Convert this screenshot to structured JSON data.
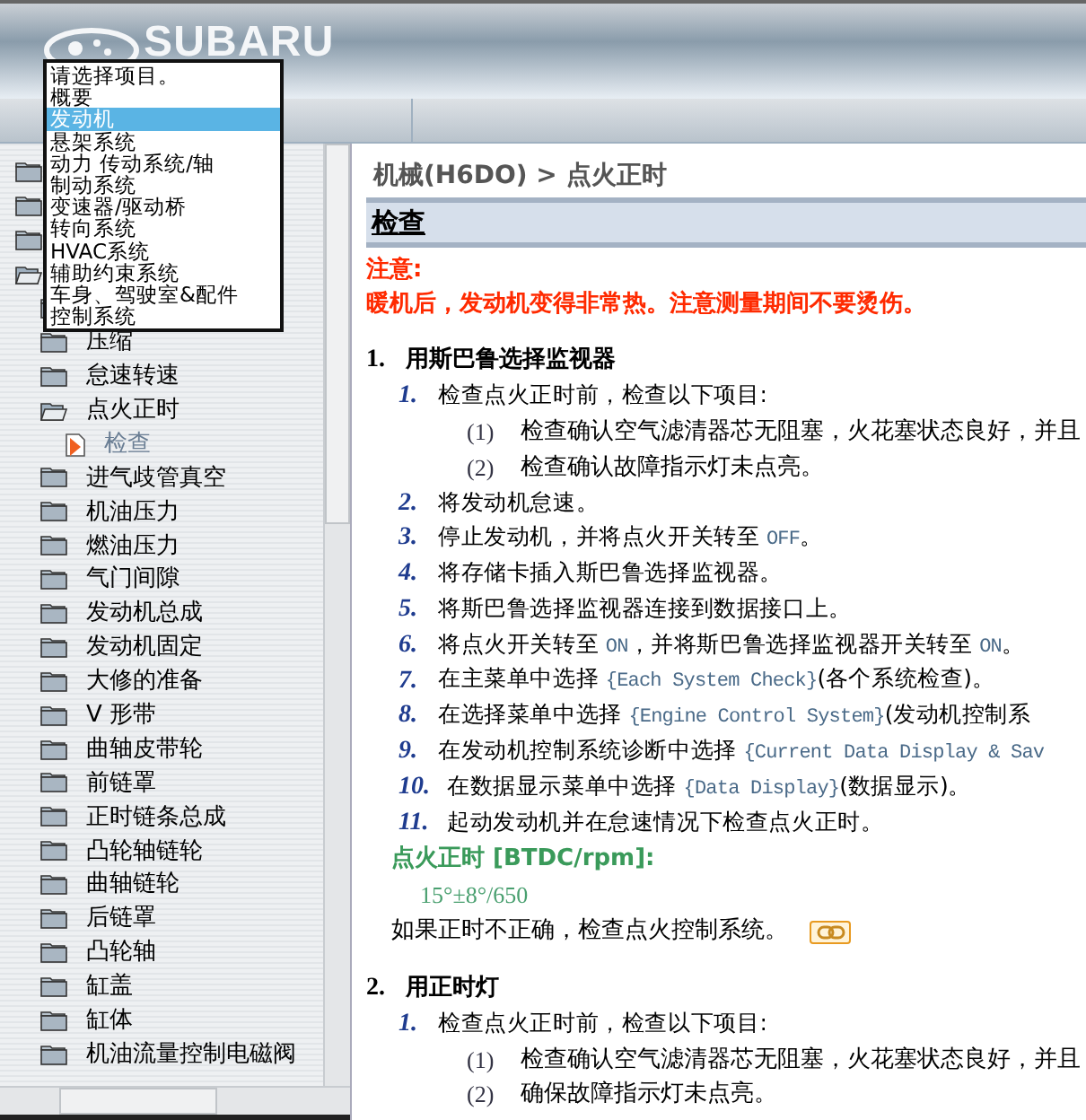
{
  "header": {
    "logo": "SUBARU"
  },
  "dropdown": {
    "items": [
      {
        "label": "请选择项目。",
        "selected": false
      },
      {
        "label": "概要",
        "selected": false
      },
      {
        "label": "发动机",
        "selected": true
      },
      {
        "label": "悬架系统",
        "selected": false
      },
      {
        "label": "动力 传动系统/轴",
        "selected": false
      },
      {
        "label": "制动系统",
        "selected": false
      },
      {
        "label": "变速器/驱动桥",
        "selected": false
      },
      {
        "label": "转向系统",
        "selected": false
      },
      {
        "label": "HVAC系统",
        "selected": false
      },
      {
        "label": "辅助约束系统",
        "selected": false
      },
      {
        "label": "车身、驾驶室&配件",
        "selected": false
      },
      {
        "label": "控制系统",
        "selected": false
      }
    ]
  },
  "tree": {
    "items": [
      {
        "kind": "folder",
        "expanded": false
      },
      {
        "kind": "folder",
        "expanded": false
      },
      {
        "kind": "folder",
        "expanded": false
      },
      {
        "kind": "folder",
        "expanded": true,
        "children": [
          {
            "kind": "folder",
            "expanded": false
          },
          {
            "kind": "folder",
            "label": "压缩",
            "expanded": false
          },
          {
            "kind": "folder",
            "label": "怠速转速",
            "expanded": false
          },
          {
            "kind": "folder",
            "label": "点火正时",
            "expanded": true,
            "children": [
              {
                "kind": "page",
                "label": "检查",
                "selected": true
              }
            ]
          },
          {
            "kind": "folder",
            "label": "进气歧管真空",
            "expanded": false
          },
          {
            "kind": "folder",
            "label": "机油压力",
            "expanded": false
          },
          {
            "kind": "folder",
            "label": "燃油压力",
            "expanded": false
          },
          {
            "kind": "folder",
            "label": "气门间隙",
            "expanded": false
          },
          {
            "kind": "folder",
            "label": "发动机总成",
            "expanded": false
          },
          {
            "kind": "folder",
            "label": "发动机固定",
            "expanded": false
          },
          {
            "kind": "folder",
            "label": "大修的准备",
            "expanded": false
          },
          {
            "kind": "folder",
            "label": "V 形带",
            "expanded": false
          },
          {
            "kind": "folder",
            "label": "曲轴皮带轮",
            "expanded": false
          },
          {
            "kind": "folder",
            "label": "前链罩",
            "expanded": false
          },
          {
            "kind": "folder",
            "label": "正时链条总成",
            "expanded": false
          },
          {
            "kind": "folder",
            "label": "凸轮轴链轮",
            "expanded": false
          },
          {
            "kind": "folder",
            "label": "曲轴链轮",
            "expanded": false
          },
          {
            "kind": "folder",
            "label": "后链罩",
            "expanded": false
          },
          {
            "kind": "folder",
            "label": "凸轮轴",
            "expanded": false
          },
          {
            "kind": "folder",
            "label": "缸盖",
            "expanded": false
          },
          {
            "kind": "folder",
            "label": "缸体",
            "expanded": false
          },
          {
            "kind": "folder",
            "label": "机油流量控制电磁阀",
            "expanded": false
          }
        ]
      }
    ]
  },
  "content": {
    "breadcrumb": "机械(H6DO) > 点火正时",
    "section_title": "检查",
    "caution": {
      "title": "注意:",
      "text": "暖机后，发动机变得非常热。注意测量期间不要烫伤。"
    },
    "procedures": [
      {
        "number": "1.",
        "title": "用斯巴鲁选择监视器",
        "steps": [
          {
            "number": "1.",
            "parts": [
              {
                "kind": "plain",
                "text": "检查点火正时前，检查以下项目:"
              }
            ],
            "substeps": [
              {
                "number": "(1)",
                "text": "检查确认空气滤清器芯无阻塞，火花塞状态良好，并且"
              },
              {
                "number": "(2)",
                "text": "检查确认故障指示灯未点亮。"
              }
            ]
          },
          {
            "number": "2.",
            "parts": [
              {
                "kind": "plain",
                "text": "将发动机怠速。"
              }
            ]
          },
          {
            "number": "3.",
            "parts": [
              {
                "kind": "plain",
                "text": "停止发动机，并将点火开关转至 "
              },
              {
                "kind": "code",
                "text": "OFF"
              },
              {
                "kind": "plain",
                "text": "。"
              }
            ]
          },
          {
            "number": "4.",
            "parts": [
              {
                "kind": "plain",
                "text": "将存储卡插入斯巴鲁选择监视器。"
              }
            ]
          },
          {
            "number": "5.",
            "parts": [
              {
                "kind": "plain",
                "text": "将斯巴鲁选择监视器连接到数据接口上。"
              }
            ]
          },
          {
            "number": "6.",
            "parts": [
              {
                "kind": "plain",
                "text": "将点火开关转至 "
              },
              {
                "kind": "code",
                "text": "ON"
              },
              {
                "kind": "plain",
                "text": "，并将斯巴鲁选择监视器开关转至 "
              },
              {
                "kind": "code",
                "text": "ON"
              },
              {
                "kind": "plain",
                "text": "。"
              }
            ]
          },
          {
            "number": "7.",
            "parts": [
              {
                "kind": "plain",
                "text": "在主菜单中选择 "
              },
              {
                "kind": "code",
                "text": "{Each System Check}"
              },
              {
                "kind": "plain",
                "text": "(各个系统检查)。"
              }
            ]
          },
          {
            "number": "8.",
            "parts": [
              {
                "kind": "plain",
                "text": "在选择菜单中选择 "
              },
              {
                "kind": "code",
                "text": "{Engine Control System}"
              },
              {
                "kind": "plain",
                "text": "(发动机控制系"
              }
            ]
          },
          {
            "number": "9.",
            "parts": [
              {
                "kind": "plain",
                "text": "在发动机控制系统诊断中选择 "
              },
              {
                "kind": "code",
                "text": "{Current Data Display & Sav"
              }
            ]
          },
          {
            "number": "10.",
            "parts": [
              {
                "kind": "plain",
                "text": "在数据显示菜单中选择 "
              },
              {
                "kind": "code",
                "text": "{Data Display}"
              },
              {
                "kind": "plain",
                "text": "(数据显示)。"
              }
            ]
          },
          {
            "number": "11.",
            "parts": [
              {
                "kind": "plain",
                "text": "起动发动机并在怠速情况下检查点火正时。"
              }
            ]
          }
        ],
        "spec": {
          "label": "点火正时 [BTDC/rpm]:",
          "value": "15°±8°/650"
        },
        "note": "如果正时不正确，检查点火控制系统。"
      },
      {
        "number": "2.",
        "title": "用正时灯",
        "steps": [
          {
            "number": "1.",
            "parts": [
              {
                "kind": "plain",
                "text": "检查点火正时前，检查以下项目:"
              }
            ],
            "substeps": [
              {
                "number": "(1)",
                "text": "检查确认空气滤清器芯无阻塞，火花塞状态良好，并且"
              },
              {
                "number": "(2)",
                "text": "确保故障指示灯未点亮。"
              }
            ]
          }
        ]
      }
    ]
  }
}
